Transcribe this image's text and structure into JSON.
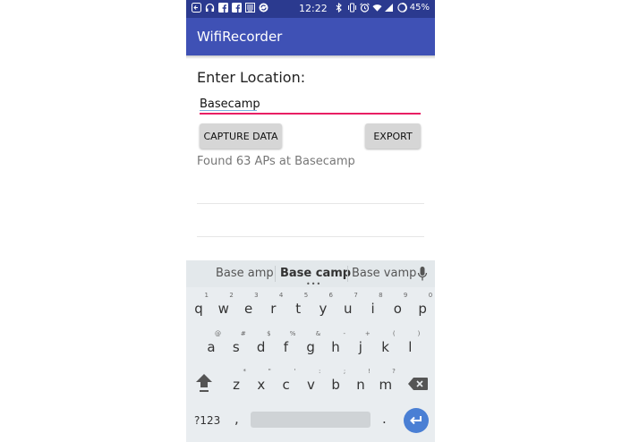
{
  "status_bar": {
    "time": "12:22",
    "battery": "45%",
    "left_icons": [
      "back-arrow-icon",
      "headphones-icon",
      "facebook-icon",
      "facebook-icon",
      "keyboard-icon",
      "sync-icon"
    ],
    "right_icons": [
      "bluetooth-icon",
      "vibrate-icon",
      "alarm-icon",
      "wifi-icon",
      "signal-icon",
      "battery-icon"
    ]
  },
  "app_bar": {
    "title": "WifiRecorder"
  },
  "form": {
    "location_label": "Enter Location:",
    "location_value": "Basecamp",
    "capture_label": "CAPTURE DATA",
    "export_label": "EXPORT",
    "status_text": "Found 63 APs at Basecamp"
  },
  "keyboard": {
    "suggestions": [
      "Base amp",
      "Base camp",
      "Base vamp"
    ],
    "row1": [
      {
        "ch": "q",
        "hint": "1"
      },
      {
        "ch": "w",
        "hint": "2"
      },
      {
        "ch": "e",
        "hint": "3"
      },
      {
        "ch": "r",
        "hint": "4"
      },
      {
        "ch": "t",
        "hint": "5"
      },
      {
        "ch": "y",
        "hint": "6"
      },
      {
        "ch": "u",
        "hint": "7"
      },
      {
        "ch": "i",
        "hint": "8"
      },
      {
        "ch": "o",
        "hint": "9"
      },
      {
        "ch": "p",
        "hint": "0"
      }
    ],
    "row2": [
      {
        "ch": "a",
        "hint": "@"
      },
      {
        "ch": "s",
        "hint": "#"
      },
      {
        "ch": "d",
        "hint": "$"
      },
      {
        "ch": "f",
        "hint": "%"
      },
      {
        "ch": "g",
        "hint": "&"
      },
      {
        "ch": "h",
        "hint": "-"
      },
      {
        "ch": "j",
        "hint": "+"
      },
      {
        "ch": "k",
        "hint": "("
      },
      {
        "ch": "l",
        "hint": ")"
      }
    ],
    "row3": [
      {
        "ch": "z",
        "hint": "*"
      },
      {
        "ch": "x",
        "hint": "\""
      },
      {
        "ch": "c",
        "hint": "'"
      },
      {
        "ch": "v",
        "hint": ":"
      },
      {
        "ch": "b",
        "hint": ";"
      },
      {
        "ch": "n",
        "hint": "!"
      },
      {
        "ch": "m",
        "hint": "?"
      }
    ],
    "symbols_label": "?123",
    "comma": ",",
    "period": "."
  },
  "colors": {
    "status_bar": "#2b3a8f",
    "app_bar": "#3f51b5",
    "input_underline": "#e91e63",
    "enter_key": "#4a7fd4"
  }
}
